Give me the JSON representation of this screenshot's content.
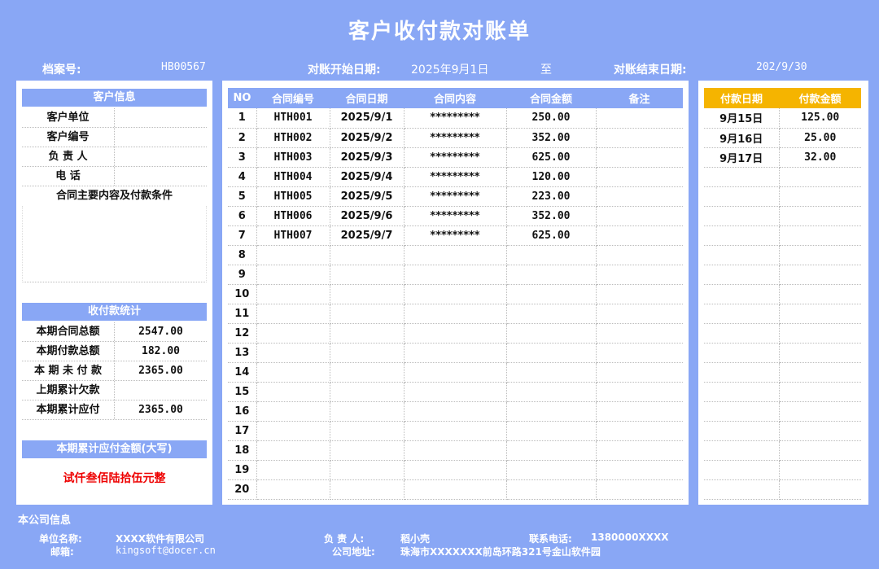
{
  "title": "客户收付款对账单",
  "header": {
    "file_no_label": "档案号:",
    "file_no": "HB00567",
    "start_label": "对账开始日期:",
    "start_date": "2025年9月1日",
    "to": "至",
    "end_label": "对账结束日期:",
    "end_date": "202/9/30"
  },
  "customer": {
    "title": "客户信息",
    "rows": [
      {
        "label": "客户单位",
        "value": ""
      },
      {
        "label": "客户编号",
        "value": ""
      },
      {
        "label": "负 责 人",
        "value": ""
      },
      {
        "label": "电    话",
        "value": ""
      }
    ],
    "conditions_label": "合同主要内容及付款条件"
  },
  "stats": {
    "title": "收付款统计",
    "rows": [
      {
        "label": "本期合同总额",
        "value": "2547.00"
      },
      {
        "label": "本期付款总额",
        "value": "182.00"
      },
      {
        "label": "本 期 未 付 款",
        "value": "2365.00"
      },
      {
        "label": "上期累计欠款",
        "value": ""
      },
      {
        "label": "本期累计应付",
        "value": "2365.00"
      }
    ],
    "uppercase_title": "本期累计应付金额(大写)",
    "uppercase_value": "试仟叁佰陆拾伍元整"
  },
  "contracts": {
    "headers": [
      "NO",
      "合同编号",
      "合同日期",
      "合同内容",
      "合同金额",
      "备注"
    ],
    "rows": [
      [
        "1",
        "HTH001",
        "2025/9/1",
        "*********",
        "250.00",
        ""
      ],
      [
        "2",
        "HTH002",
        "2025/9/2",
        "*********",
        "352.00",
        ""
      ],
      [
        "3",
        "HTH003",
        "2025/9/3",
        "*********",
        "625.00",
        ""
      ],
      [
        "4",
        "HTH004",
        "2025/9/4",
        "*********",
        "120.00",
        ""
      ],
      [
        "5",
        "HTH005",
        "2025/9/5",
        "*********",
        "223.00",
        ""
      ],
      [
        "6",
        "HTH006",
        "2025/9/6",
        "*********",
        "352.00",
        ""
      ],
      [
        "7",
        "HTH007",
        "2025/9/7",
        "*********",
        "625.00",
        ""
      ],
      [
        "8",
        "",
        "",
        "",
        "",
        ""
      ],
      [
        "9",
        "",
        "",
        "",
        "",
        ""
      ],
      [
        "10",
        "",
        "",
        "",
        "",
        ""
      ],
      [
        "11",
        "",
        "",
        "",
        "",
        ""
      ],
      [
        "12",
        "",
        "",
        "",
        "",
        ""
      ],
      [
        "13",
        "",
        "",
        "",
        "",
        ""
      ],
      [
        "14",
        "",
        "",
        "",
        "",
        ""
      ],
      [
        "15",
        "",
        "",
        "",
        "",
        ""
      ],
      [
        "16",
        "",
        "",
        "",
        "",
        ""
      ],
      [
        "17",
        "",
        "",
        "",
        "",
        ""
      ],
      [
        "18",
        "",
        "",
        "",
        "",
        ""
      ],
      [
        "19",
        "",
        "",
        "",
        "",
        ""
      ],
      [
        "20",
        "",
        "",
        "",
        "",
        ""
      ]
    ]
  },
  "payments": {
    "headers": [
      "付款日期",
      "付款金额"
    ],
    "rows": [
      [
        "9月15日",
        "125.00"
      ],
      [
        "9月16日",
        "25.00"
      ],
      [
        "9月17日",
        "32.00"
      ],
      [
        "",
        ""
      ],
      [
        "",
        ""
      ],
      [
        "",
        ""
      ],
      [
        "",
        ""
      ],
      [
        "",
        ""
      ],
      [
        "",
        ""
      ],
      [
        "",
        ""
      ],
      [
        "",
        ""
      ],
      [
        "",
        ""
      ],
      [
        "",
        ""
      ],
      [
        "",
        ""
      ],
      [
        "",
        ""
      ],
      [
        "",
        ""
      ],
      [
        "",
        ""
      ],
      [
        "",
        ""
      ],
      [
        "",
        ""
      ],
      [
        "",
        ""
      ]
    ]
  },
  "company": {
    "title": "本公司信息",
    "name_label": "单位名称:",
    "name": "XXXX软件有限公司",
    "email_label": "邮箱:",
    "email": "kingsoft@docer.cn",
    "manager_label": "负  责  人:",
    "manager": "稻小壳",
    "address_label": "公司地址:",
    "address": "珠海市XXXXXXX前岛环路321号金山软件园",
    "phone_label": "联系电话:",
    "phone": "1380000XXXX"
  }
}
